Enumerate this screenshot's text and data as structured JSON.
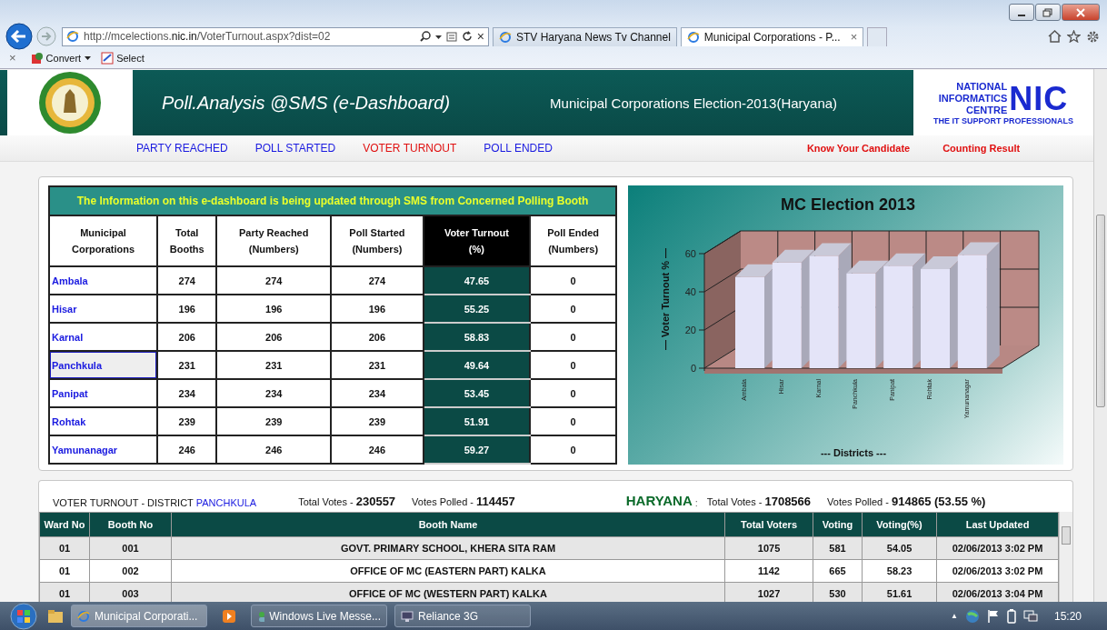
{
  "browser": {
    "url_prefix": "http://mcelections.",
    "url_domain": "nic.in",
    "url_path": "/VoterTurnout.aspx?dist=02",
    "tabs": [
      {
        "label": "STV Haryana News Tv Channel",
        "selected": false
      },
      {
        "label": "Municipal Corporations - P...",
        "selected": true
      }
    ],
    "tab_close": "×",
    "stop": "×",
    "toolbar": [
      "Convert",
      "Select"
    ]
  },
  "header": {
    "title": "Poll.Analysis @SMS (e-Dashboard)",
    "subtitle": "Municipal Corporations Election-2013(Haryana)",
    "nic": {
      "line1": "NATIONAL",
      "line2": "INFORMATICS",
      "line3": "CENTRE",
      "mark": "NIC",
      "tagline": "THE IT SUPPORT PROFESSIONALS"
    }
  },
  "nav": [
    {
      "label": "PARTY REACHED",
      "selected": false
    },
    {
      "label": "POLL STARTED",
      "selected": false
    },
    {
      "label": "VOTER TURNOUT",
      "selected": true
    },
    {
      "label": "POLL ENDED",
      "selected": false
    }
  ],
  "nav_links": [
    "Know Your Candidate",
    "Counting Result"
  ],
  "summary_table": {
    "banner": "The Information on this e-dashboard is being updated through SMS from Concerned Polling Booth",
    "columns": [
      [
        "Municipal",
        "Corporations"
      ],
      [
        "Total",
        "Booths"
      ],
      [
        "Party Reached",
        "(Numbers)"
      ],
      [
        "Poll Started",
        "(Numbers)"
      ],
      [
        "Voter Turnout",
        "(%)"
      ],
      [
        "Poll Ended",
        "(Numbers)"
      ]
    ],
    "rows": [
      {
        "name": "Ambala",
        "booths": "274",
        "reached": "274",
        "started": "274",
        "turnout": "47.65",
        "ended": "0",
        "selected": false
      },
      {
        "name": "Hisar",
        "booths": "196",
        "reached": "196",
        "started": "196",
        "turnout": "55.25",
        "ended": "0",
        "selected": false
      },
      {
        "name": "Karnal",
        "booths": "206",
        "reached": "206",
        "started": "206",
        "turnout": "58.83",
        "ended": "0",
        "selected": false
      },
      {
        "name": "Panchkula",
        "booths": "231",
        "reached": "231",
        "started": "231",
        "turnout": "49.64",
        "ended": "0",
        "selected": true
      },
      {
        "name": "Panipat",
        "booths": "234",
        "reached": "234",
        "started": "234",
        "turnout": "53.45",
        "ended": "0",
        "selected": false
      },
      {
        "name": "Rohtak",
        "booths": "239",
        "reached": "239",
        "started": "239",
        "turnout": "51.91",
        "ended": "0",
        "selected": false
      },
      {
        "name": "Yamunanagar",
        "booths": "246",
        "reached": "246",
        "started": "246",
        "turnout": "59.27",
        "ended": "0",
        "selected": false
      }
    ]
  },
  "chart": {
    "chart_data": {
      "type": "bar",
      "title": "MC Election 2013",
      "xlabel": "--- Districts ---",
      "ylabel": "— Voter Turnout % —",
      "categories": [
        "Ambala",
        "Hisar",
        "Karnal",
        "Panchkula",
        "Panipat",
        "Rohtak",
        "Yamunanagar"
      ],
      "values": [
        47.7,
        55.3,
        58.8,
        49.6,
        53.5,
        51.9,
        59.3
      ],
      "ylim": [
        0,
        60
      ],
      "yticks": [
        0,
        20,
        40,
        60
      ]
    }
  },
  "district_summary": {
    "label": "VOTER TURNOUT - DISTRICT",
    "district": "PANCHKULA",
    "figures": [
      {
        "label": "Total Votes -",
        "value": "230557"
      },
      {
        "label": "Votes Polled -",
        "value": "114457"
      }
    ]
  },
  "state_summary": {
    "name": "HARYANA",
    "separator": ":",
    "figures": [
      {
        "label": "Total Votes -",
        "value": "1708566"
      },
      {
        "label": "Votes Polled -",
        "value": "914865 (53.55 %)"
      }
    ]
  },
  "booth_table": {
    "columns": [
      "Ward No",
      "Booth No",
      "Booth Name",
      "Total Voters",
      "Voting",
      "Voting(%)",
      "Last Updated"
    ],
    "rows": [
      [
        "01",
        "001",
        "GOVT. PRIMARY SCHOOL, KHERA SITA RAM",
        "1075",
        "581",
        "54.05",
        "02/06/2013 3:02 PM"
      ],
      [
        "01",
        "002",
        "OFFICE OF MC (EASTERN PART) KALKA",
        "1142",
        "665",
        "58.23",
        "02/06/2013 3:02 PM"
      ],
      [
        "01",
        "003",
        "OFFICE OF MC (WESTERN PART) KALKA",
        "1027",
        "530",
        "51.61",
        "02/06/2013 3:04 PM"
      ]
    ]
  },
  "taskbar": {
    "windows": [
      "Municipal Corporati...",
      "Windows Live Messe...",
      "Reliance 3G"
    ],
    "tray_arrow": "▲",
    "clock": "15:20"
  }
}
